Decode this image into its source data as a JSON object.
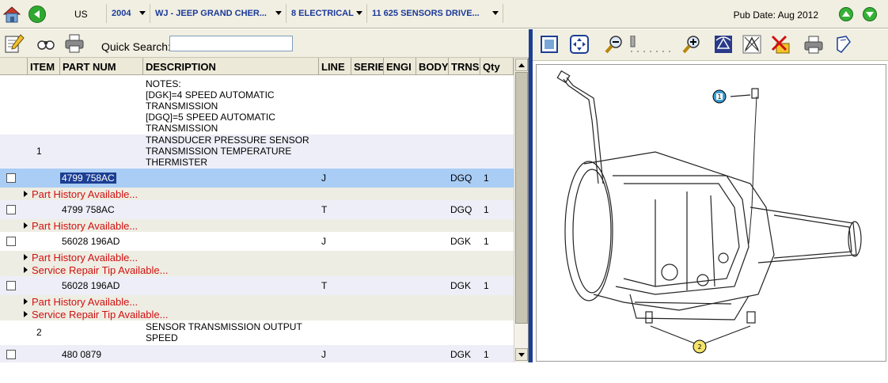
{
  "topbar": {
    "country": "US",
    "year": "2004",
    "model": "WJ - JEEP GRAND CHER...",
    "group": "8 ELECTRICAL",
    "subgroup": "11 625 SENSORS DRIVE...",
    "pub_date": "Pub Date: Aug 2012",
    "icons": [
      "home-icon",
      "back-icon",
      "arrow-up-icon",
      "arrow-down-icon"
    ]
  },
  "left_toolbar": {
    "quick_search_label": "Quick Search:",
    "quick_search_value": "",
    "icons": [
      "notes-icon",
      "binoculars-icon",
      "print-icon"
    ]
  },
  "columns": [
    "ITEM",
    "PART NUM",
    "DESCRIPTION",
    "LINE",
    "SERIE",
    "ENGI",
    "BODY",
    "TRNS",
    "Qty"
  ],
  "rows": [
    {
      "type": "note",
      "description": "NOTES:\n[DGK]=4 SPEED AUTOMATIC TRANSMISSION\n[DGQ]=5 SPEED AUTOMATIC TRANSMISSION"
    },
    {
      "type": "item",
      "item": "1",
      "description": "TRANSDUCER PRESSURE SENSOR TRANSMISSION TEMPERATURE THERMISTER"
    },
    {
      "type": "part",
      "part": "4799 758AC",
      "line": "J",
      "trns": "DGQ",
      "qty": "1",
      "selected": true
    },
    {
      "type": "link",
      "text": "Part History Available..."
    },
    {
      "type": "part",
      "part": "4799 758AC",
      "line": "T",
      "trns": "DGQ",
      "qty": "1"
    },
    {
      "type": "link",
      "text": "Part History Available..."
    },
    {
      "type": "part",
      "part": "56028 196AD",
      "line": "J",
      "trns": "DGK",
      "qty": "1"
    },
    {
      "type": "link",
      "text": "Part History Available..."
    },
    {
      "type": "link",
      "text": "Service Repair Tip Available..."
    },
    {
      "type": "part",
      "part": "56028 196AD",
      "line": "T",
      "trns": "DGK",
      "qty": "1"
    },
    {
      "type": "link",
      "text": "Part History Available..."
    },
    {
      "type": "link",
      "text": "Service Repair Tip Available..."
    },
    {
      "type": "item",
      "item": "2",
      "description": "SENSOR TRANSMISSION OUTPUT SPEED"
    },
    {
      "type": "part",
      "part": "480 0879",
      "line": "J",
      "trns": "DGK",
      "qty": "1"
    }
  ],
  "right_toolbar": {
    "icons": [
      "fit-page-icon",
      "fit-window-icon",
      "zoom-out-icon",
      "zoom-slider",
      "zoom-in-icon",
      "rotate-icon",
      "callouts-icon",
      "remove-highlight-icon",
      "print-icon",
      "bookmark-icon"
    ]
  },
  "diagram": {
    "callouts": [
      "1",
      "2"
    ]
  },
  "colors": {
    "selected_row": "#a9cdf5",
    "link_red": "#d01010",
    "header_blue": "#1b3a9a",
    "frame_blue": "#1c3f93"
  }
}
